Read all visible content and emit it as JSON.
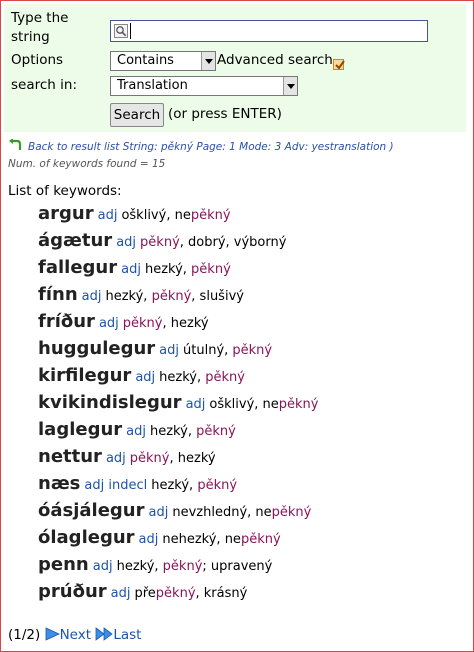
{
  "search": {
    "label": "Type the string",
    "value": "",
    "options_label": "Options",
    "mode_selected": "Contains",
    "advanced_label": "Advanced search",
    "advanced_checked": true,
    "search_in_label": "search in:",
    "field_selected": "Translation",
    "button_label": "Search",
    "hint": "(or press ENTER)"
  },
  "info": {
    "back_text": "Back to result list String: pěkný Page: 1 Mode: 3 Adv: yestranslation )",
    "found_text": "Num. of keywords found = 15"
  },
  "keywords_title": "List of keywords:",
  "entries": [
    {
      "head": "argur",
      "pos": "adj",
      "parts": [
        {
          "t": "ošklivý, ne",
          "h": false
        },
        {
          "t": "pěkný",
          "h": true
        }
      ]
    },
    {
      "head": "ágætur",
      "pos": "adj",
      "parts": [
        {
          "t": "pěkný",
          "h": true
        },
        {
          "t": ", dobrý, výborný",
          "h": false
        }
      ]
    },
    {
      "head": "fallegur",
      "pos": "adj",
      "parts": [
        {
          "t": "hezký, ",
          "h": false
        },
        {
          "t": "pěkný",
          "h": true
        }
      ]
    },
    {
      "head": "fínn",
      "pos": "adj",
      "parts": [
        {
          "t": "hezký, ",
          "h": false
        },
        {
          "t": "pěkný",
          "h": true
        },
        {
          "t": ", slušivý",
          "h": false
        }
      ]
    },
    {
      "head": "fríður",
      "pos": "adj",
      "parts": [
        {
          "t": "pěkný",
          "h": true
        },
        {
          "t": ", hezký",
          "h": false
        }
      ]
    },
    {
      "head": "huggulegur",
      "pos": "adj",
      "parts": [
        {
          "t": "útulný, ",
          "h": false
        },
        {
          "t": "pěkný",
          "h": true
        }
      ]
    },
    {
      "head": "kirfilegur",
      "pos": "adj",
      "parts": [
        {
          "t": "hezký, ",
          "h": false
        },
        {
          "t": "pěkný",
          "h": true
        }
      ]
    },
    {
      "head": "kvikindislegur",
      "pos": "adj",
      "parts": [
        {
          "t": "ošklivý, ne",
          "h": false
        },
        {
          "t": "pěkný",
          "h": true
        }
      ]
    },
    {
      "head": "laglegur",
      "pos": "adj",
      "parts": [
        {
          "t": "hezký, ",
          "h": false
        },
        {
          "t": "pěkný",
          "h": true
        }
      ]
    },
    {
      "head": "nettur",
      "pos": "adj",
      "parts": [
        {
          "t": "pěkný",
          "h": true
        },
        {
          "t": ", hezký",
          "h": false
        }
      ]
    },
    {
      "head": "næs",
      "pos": "adj indecl",
      "parts": [
        {
          "t": "hezký, ",
          "h": false
        },
        {
          "t": "pěkný",
          "h": true
        }
      ]
    },
    {
      "head": "óásjálegur",
      "pos": "adj",
      "parts": [
        {
          "t": "nevzhledný, ne",
          "h": false
        },
        {
          "t": "pěkný",
          "h": true
        }
      ]
    },
    {
      "head": "ólaglegur",
      "pos": "adj",
      "parts": [
        {
          "t": "nehezký, ne",
          "h": false
        },
        {
          "t": "pěkný",
          "h": true
        }
      ]
    },
    {
      "head": "penn",
      "pos": "adj",
      "parts": [
        {
          "t": "hezký, ",
          "h": false
        },
        {
          "t": "pěkný",
          "h": true
        },
        {
          "t": "; upravený",
          "h": false
        }
      ]
    },
    {
      "head": "prúður",
      "pos": "adj",
      "parts": [
        {
          "t": "pře",
          "h": false
        },
        {
          "t": "pěkný",
          "h": true
        },
        {
          "t": ", krásný",
          "h": false
        }
      ]
    }
  ],
  "pager": {
    "page_indicator": "(1/2)",
    "next_label": "Next",
    "last_label": "Last"
  },
  "colors": {
    "panel_bg": "#edfbe9",
    "frame_border": "#dd4444",
    "highlight": "#8a1459",
    "link": "#1c55a8"
  },
  "icons": {
    "back": "back-arrow-icon",
    "search_field": "magnifier-icon",
    "next": "next-arrow-icon",
    "last": "last-arrow-icon"
  }
}
